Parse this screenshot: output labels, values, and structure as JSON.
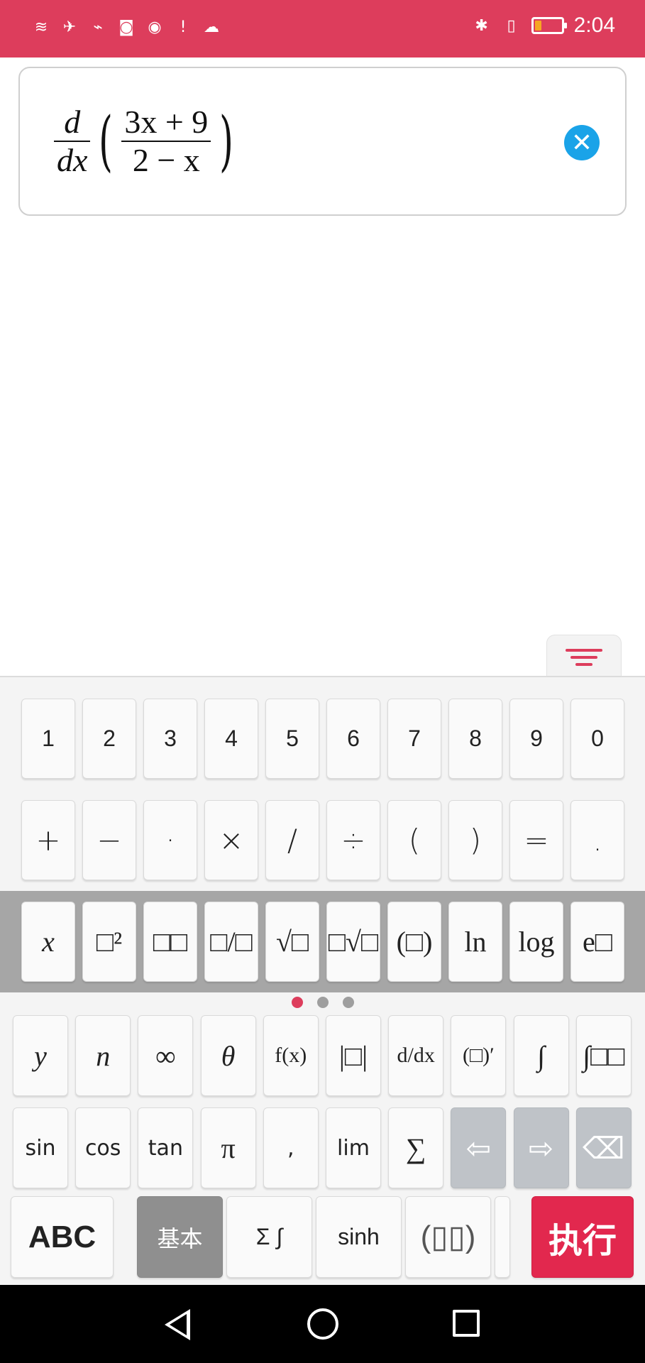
{
  "status_bar": {
    "left_icons": [
      "wifi-icon",
      "airplane-mode-icon",
      "activity-icon",
      "game-icon",
      "browser-icon",
      "alert-icon",
      "uc-browser-icon"
    ],
    "left_glyphs": [
      "≋",
      "✈",
      "⌁",
      "◙",
      "◉",
      "!",
      "☁"
    ],
    "bluetooth_glyph": "✱",
    "vibrate_glyph": "▯",
    "battery_level": 0.25,
    "time": "2:04",
    "background_color": "#dd3d5c"
  },
  "expression": {
    "outer_num": "d",
    "outer_den": "dx",
    "inner_num": "3x + 9",
    "inner_den": "2 − x",
    "left_paren": "(",
    "right_paren": ")",
    "clear_glyph": "✕"
  },
  "keyboard": {
    "filter_icon": "filter-icon",
    "row_digits": [
      "1",
      "2",
      "3",
      "4",
      "5",
      "6",
      "7",
      "8",
      "9",
      "0"
    ],
    "row_operators": [
      "+",
      "−",
      "·",
      "×",
      "/",
      "÷",
      "(",
      ")",
      "=",
      "."
    ],
    "row_templates": [
      "x",
      "□²",
      "□□",
      "□/□",
      "√□",
      "□√□",
      "(□)",
      "ln",
      "log",
      "e□"
    ],
    "page_dots": 3,
    "active_page": 1,
    "row_symbols": [
      "y",
      "n",
      "∞",
      "θ",
      "f(x)",
      "|□|",
      "d/dx",
      "(□)′",
      "∫",
      "∫□□"
    ],
    "row_functions": [
      "sin",
      "cos",
      "tan",
      "π",
      ",",
      "lim",
      "∑",
      "⇦",
      "⇨",
      "⌫"
    ],
    "bottom": {
      "abc": "ABC",
      "basic": "基本",
      "sigma_integral": "Σ ∫",
      "sinh": "sinh",
      "matrix": "(▯▯)",
      "execute": "执行"
    },
    "accent_color": "#e2284e"
  },
  "nav_bar": {
    "icons": [
      "back-icon",
      "home-icon",
      "recent-apps-icon"
    ]
  }
}
